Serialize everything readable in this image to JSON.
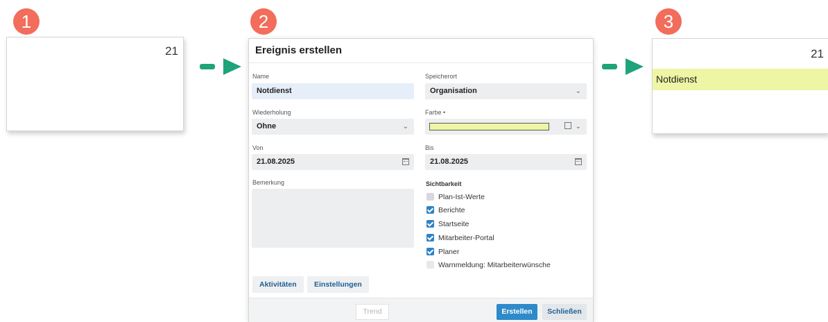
{
  "steps": [
    "1",
    "2",
    "3"
  ],
  "panel1": {
    "day": "21"
  },
  "panel3": {
    "day": "21",
    "event_title": "Notdienst",
    "event_color": "#eef5a4"
  },
  "dialog": {
    "title": "Ereignis erstellen",
    "name": {
      "label": "Name",
      "value": "Notdienst"
    },
    "location": {
      "label": "Speicherort",
      "value": "Organisation"
    },
    "repeat": {
      "label": "Wiederholung",
      "value": "Ohne"
    },
    "color": {
      "label": "Farbe •",
      "value": "#eef5a4"
    },
    "from": {
      "label": "Von",
      "value": "21.08.2025"
    },
    "to": {
      "label": "Bis",
      "value": "21.08.2025"
    },
    "remark": {
      "label": "Bemerkung",
      "value": ""
    },
    "visibility": {
      "label": "Sichtbarkeit",
      "options": [
        {
          "label": "Plan-Ist-Werte",
          "checked": false
        },
        {
          "label": "Berichte",
          "checked": true
        },
        {
          "label": "Startseite",
          "checked": true
        },
        {
          "label": "Mitarbeiter-Portal",
          "checked": true
        },
        {
          "label": "Planer",
          "checked": true
        },
        {
          "label": "Warnmeldung: Mitarbeiterwünsche",
          "checked": false
        }
      ]
    },
    "buttons": {
      "activities": "Aktivitäten",
      "settings": "Einstellungen",
      "trend": "Trend",
      "create": "Erstellen",
      "close": "Schließen"
    }
  },
  "colors": {
    "accent": "#2f8ac9",
    "badge": "#f26d5b",
    "arrow": "#1fa37a",
    "event": "#eef5a4"
  }
}
